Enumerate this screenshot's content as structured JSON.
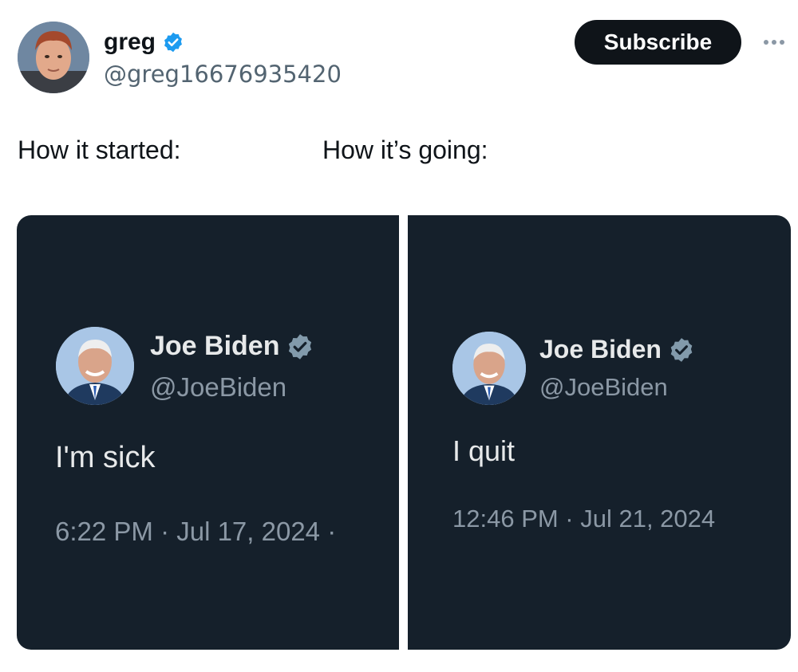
{
  "author": {
    "display_name": "greg",
    "handle": "@greg16676935420",
    "verified_icon": "verified-badge-icon"
  },
  "actions": {
    "subscribe_label": "Subscribe",
    "more_icon": "more-icon"
  },
  "captions": {
    "left": "How it started:",
    "right": "How it’s going:"
  },
  "embedded_tweets": [
    {
      "name": "Joe Biden",
      "handle": "@JoeBiden",
      "text": "I'm sick",
      "timestamp": "6:22 PM · Jul 17, 2024 ·"
    },
    {
      "name": "Joe Biden",
      "handle": "@JoeBiden",
      "text": "I quit",
      "timestamp": "12:46 PM · Jul 21, 2024"
    }
  ],
  "colors": {
    "verified_blue": "#1d9bf0",
    "tweet_bg": "#15202b",
    "subscribe_bg": "#0f1419",
    "secondary_text": "#536471"
  }
}
